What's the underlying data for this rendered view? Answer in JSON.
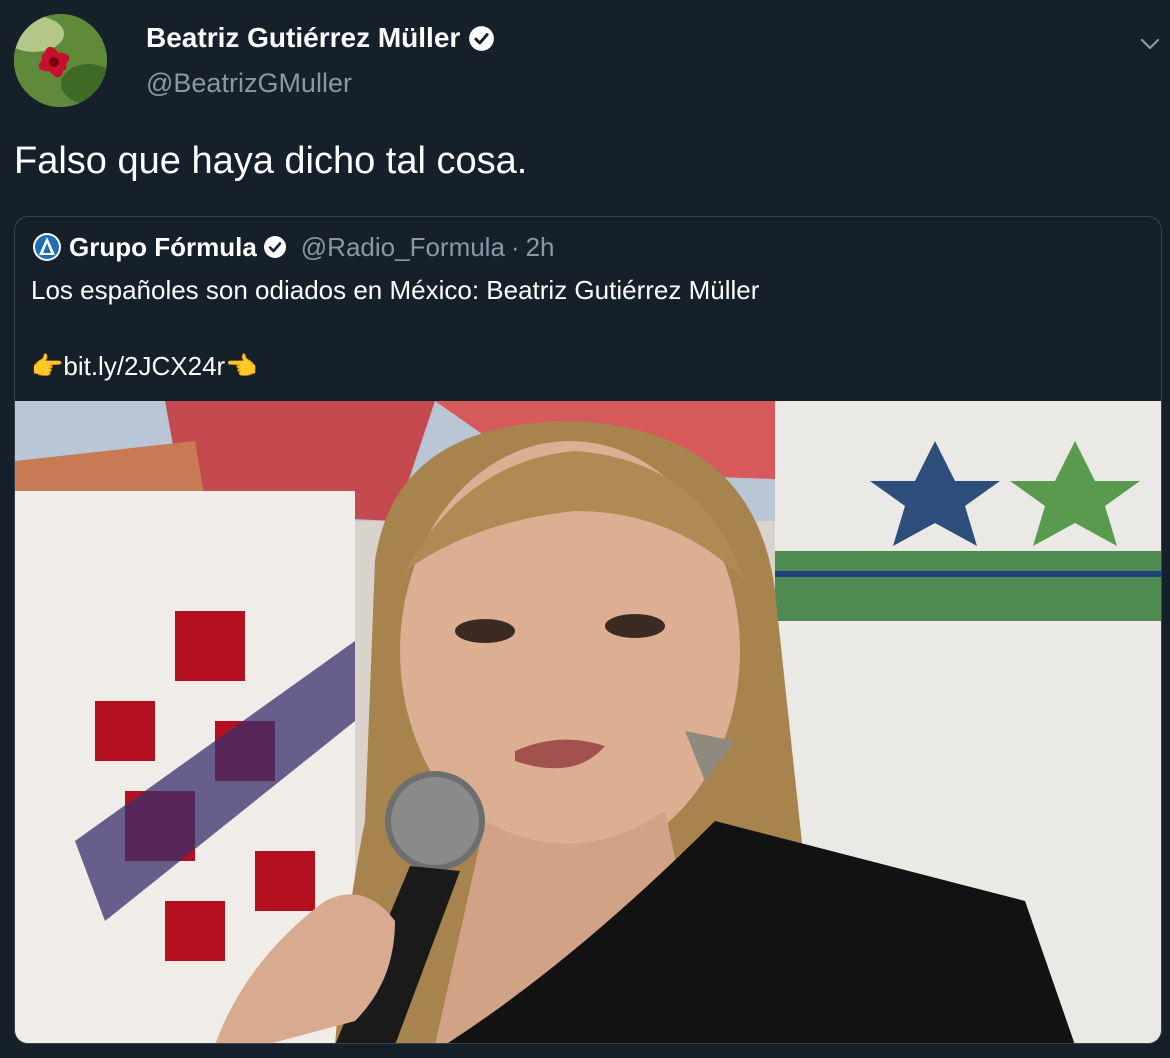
{
  "tweet": {
    "author_name": "Beatriz Gutiérrez Müller",
    "author_handle": "@BeatrizGMuller",
    "text": "Falso que haya dicho tal cosa."
  },
  "quoted_tweet": {
    "author_name": "Grupo Fórmula",
    "author_handle": "@Radio_Formula",
    "separator": "·",
    "time": "2h",
    "text": "Los españoles son odiados en México: Beatriz Gutiérrez Müller",
    "link": "bit.ly/2JCX24r",
    "link_prefix_emoji": "👉",
    "link_suffix_emoji": "👈"
  },
  "icons": {
    "verified": "verified-badge-icon",
    "menu": "chevron-down-icon",
    "quote_logo": "grupo-formula-logo-icon"
  },
  "colors": {
    "background": "#15202b",
    "secondary_text": "#8899a6",
    "border": "#38444d"
  }
}
